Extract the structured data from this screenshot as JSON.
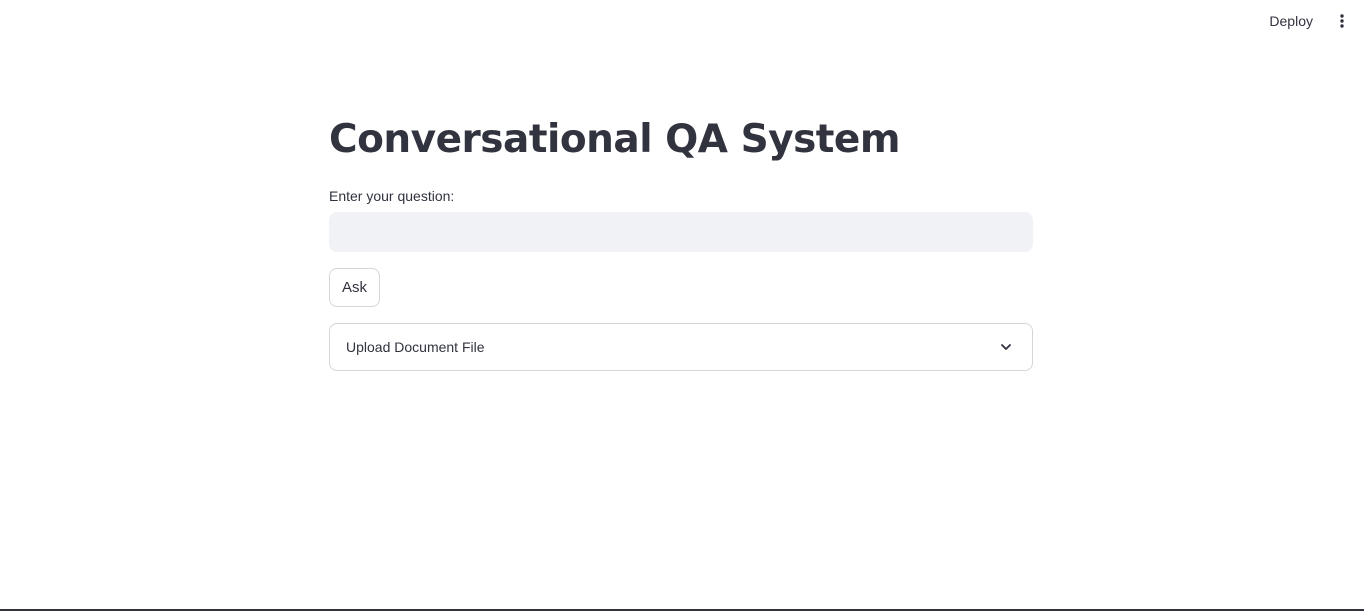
{
  "toolbar": {
    "deploy_label": "Deploy",
    "menu_icon": "kebab-menu-icon"
  },
  "main": {
    "title": "Conversational QA System",
    "question_label": "Enter your question:",
    "question_value": "",
    "question_placeholder": "",
    "ask_label": "Ask",
    "expander_label": "Upload Document File",
    "expander_icon": "chevron-down-icon"
  },
  "colors": {
    "text": "#31333f",
    "input_bg": "#f0f2f6",
    "border": "#d6d6d9",
    "background": "#ffffff"
  }
}
